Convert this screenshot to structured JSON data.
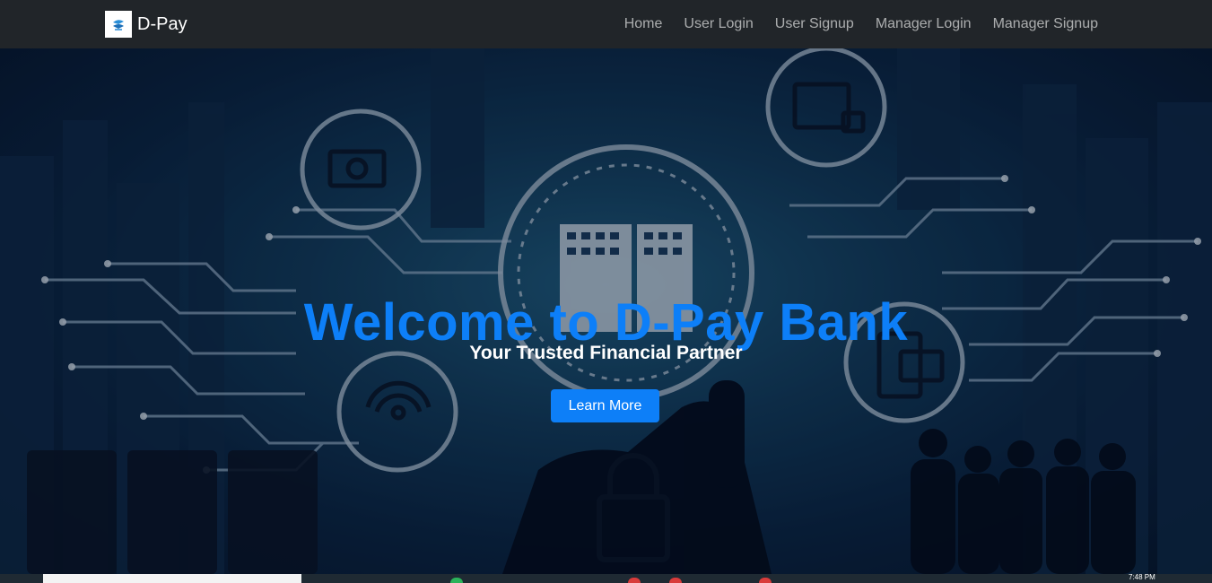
{
  "brand": {
    "name": "D-Pay",
    "logo_icon": "dpay-logo-icon"
  },
  "nav": {
    "items": [
      {
        "label": "Home"
      },
      {
        "label": "User Login"
      },
      {
        "label": "User Signup"
      },
      {
        "label": "Manager Login"
      },
      {
        "label": "Manager Signup"
      }
    ]
  },
  "hero": {
    "title": "Welcome to D-Pay Bank",
    "subtitle": "Your Trusted Financial Partner",
    "cta_label": "Learn More"
  },
  "taskbar": {
    "clock": "7:48 PM"
  },
  "colors": {
    "navbar_bg": "#212529",
    "accent": "#0d7ff8",
    "nav_link": "rgba(255,255,255,0.62)"
  }
}
